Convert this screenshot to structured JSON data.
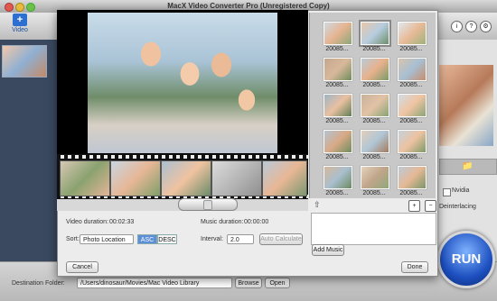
{
  "window": {
    "title": "MacX Video Converter Pro (Unregistered Copy)"
  },
  "toolbar": {
    "video_label": "Video",
    "video_icon": "add-video-icon"
  },
  "dialog": {
    "video_duration_label": "Video duration:",
    "video_duration_value": "00:02:33",
    "music_duration_label": "Music duration:",
    "music_duration_value": "00:00:00",
    "sort_label": "Sort:",
    "sort_value": "Photo Location",
    "asc_label": "ASC",
    "desc_label": "DESC",
    "interval_label": "Interval:",
    "interval_value": "2.0",
    "auto_calculate_label": "Auto Calculate",
    "cancel_label": "Cancel",
    "done_label": "Done",
    "add_music_label": "Add Music",
    "add_photo_icon": "add-icon",
    "remove_photo_icon": "minus-icon",
    "move_up_icon": "up-arrow-icon"
  },
  "photos": [
    {
      "label": "20085..."
    },
    {
      "label": "20085..."
    },
    {
      "label": "20085..."
    },
    {
      "label": "20085..."
    },
    {
      "label": "20085..."
    },
    {
      "label": "20085..."
    },
    {
      "label": "20085..."
    },
    {
      "label": "20085..."
    },
    {
      "label": "20085..."
    },
    {
      "label": "20085..."
    },
    {
      "label": "20085..."
    },
    {
      "label": "20085..."
    },
    {
      "label": "20085..."
    },
    {
      "label": "20085..."
    },
    {
      "label": "20085..."
    }
  ],
  "side_options": {
    "nvidia_label": "Nvidia",
    "deinterlacing_label": "Deinterlacing"
  },
  "bottom": {
    "destination_label": "Destination Folder:",
    "destination_value": "/Users/dinosaur/Movies/Mac Video Library",
    "browse_label": "Browse",
    "open_label": "Open",
    "run_label": "RUN"
  }
}
